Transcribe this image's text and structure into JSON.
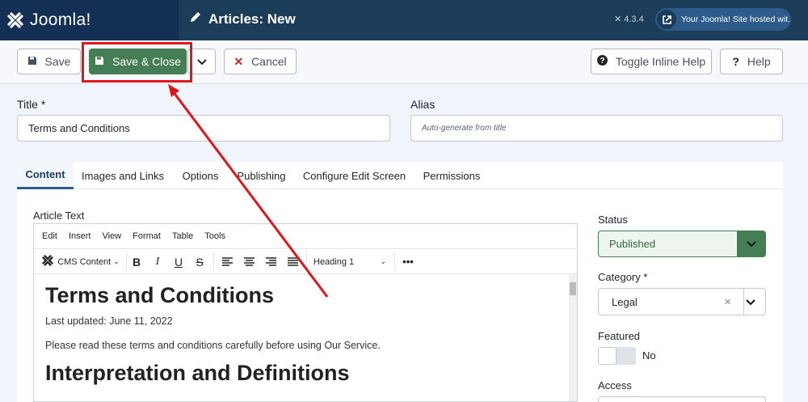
{
  "header": {
    "logo_text": "Joomla!",
    "page_title": "Articles: New",
    "version": "4.3.4",
    "site_link": "Your Joomla! Site hosted wit..."
  },
  "toolbar": {
    "save_label": "Save",
    "save_close_label": "Save & Close",
    "cancel_label": "Cancel",
    "inline_help_label": "Toggle Inline Help",
    "help_label": "Help"
  },
  "form": {
    "title_label": "Title *",
    "title_value": "Terms and Conditions",
    "alias_label": "Alias",
    "alias_placeholder": "Auto-generate from title"
  },
  "tabs": [
    {
      "label": "Content"
    },
    {
      "label": "Images and Links"
    },
    {
      "label": "Options"
    },
    {
      "label": "Publishing"
    },
    {
      "label": "Configure Edit Screen"
    },
    {
      "label": "Permissions"
    }
  ],
  "editor": {
    "label": "Article Text",
    "menu": [
      "Edit",
      "Insert",
      "View",
      "Format",
      "Table",
      "Tools"
    ],
    "cms_content": "CMS Content",
    "block_format": "Heading 1",
    "doc": {
      "h1": "Terms and Conditions",
      "updated": "Last updated: June 11, 2022",
      "intro": "Please read these terms and conditions carefully before using Our Service.",
      "h2": "Interpretation and Definitions"
    }
  },
  "sidebar": {
    "status_label": "Status",
    "status_value": "Published",
    "category_label": "Category *",
    "category_value": "Legal",
    "featured_label": "Featured",
    "featured_value": "No",
    "access_label": "Access"
  },
  "colors": {
    "header": "#1c3d5a",
    "accent_green": "#457d54",
    "highlight_red": "#e0161b"
  }
}
